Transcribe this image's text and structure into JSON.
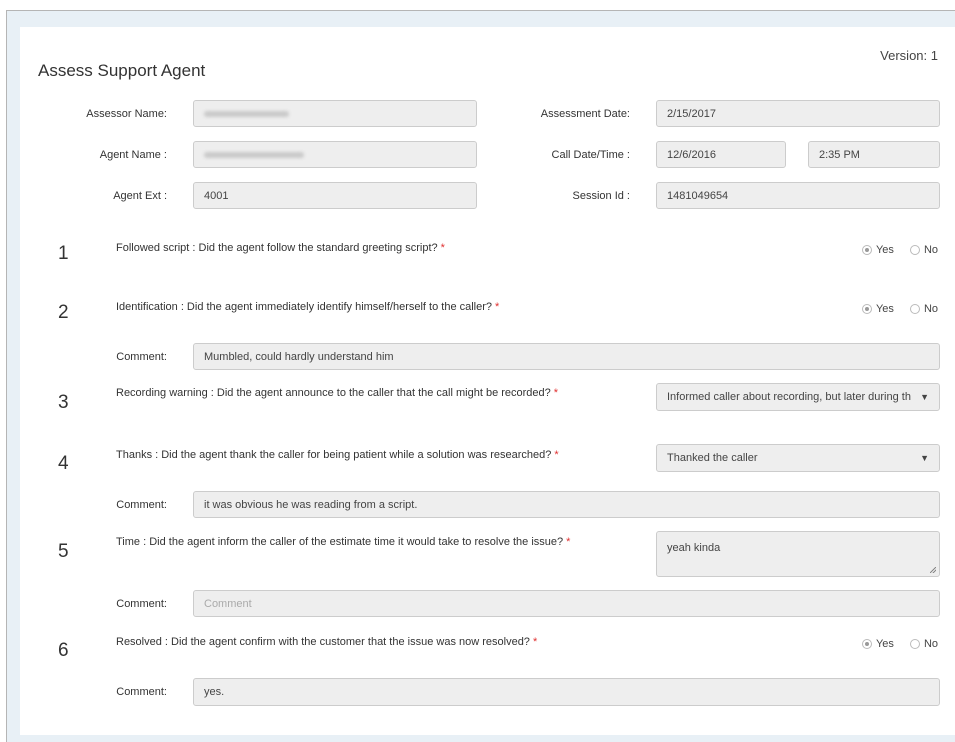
{
  "form": {
    "title": "Assess Support Agent",
    "version": "Version: 1"
  },
  "header_fields": {
    "assessor_name_label": "Assessor Name:",
    "assessment_date_label": "Assessment Date:",
    "assessment_date_value": "2/15/2017",
    "agent_name_label": "Agent Name :",
    "call_datetime_label": "Call Date/Time :",
    "call_date_value": "12/6/2016",
    "call_time_value": "2:35 PM",
    "agent_ext_label": "Agent Ext :",
    "agent_ext_value": "4001",
    "session_id_label": "Session Id :",
    "session_id_value": "1481049654"
  },
  "questions": [
    {
      "number": "1",
      "text": "Followed script : Did the agent follow the standard greeting script?",
      "required": "*",
      "answer": "Yes"
    },
    {
      "number": "2",
      "text": "Identification : Did the agent immediately identify himself/herself to the caller?",
      "required": "*",
      "answer": "Yes",
      "comment": "Mumbled, could hardly understand him"
    },
    {
      "number": "3",
      "text": "Recording warning : Did the agent announce to the caller that the call might be recorded?",
      "required": "*",
      "selected": "Informed caller about recording, but later during th"
    },
    {
      "number": "4",
      "text": "Thanks : Did the agent thank the caller for being patient while a solution was researched?",
      "required": "*",
      "selected": "Thanked the caller",
      "comment": "it was obvious he was reading from a script."
    },
    {
      "number": "5",
      "text": "Time : Did the agent inform the caller of the estimate time it would take to resolve the issue?",
      "required": "*",
      "answer_text": "yeah kinda",
      "comment_placeholder": "Comment"
    },
    {
      "number": "6",
      "text": "Resolved : Did the agent confirm with the customer that the issue was now resolved?",
      "required": "*",
      "answer": "Yes",
      "comment": "yes."
    }
  ],
  "labels": {
    "yes": "Yes",
    "no": "No",
    "comment": "Comment:"
  }
}
